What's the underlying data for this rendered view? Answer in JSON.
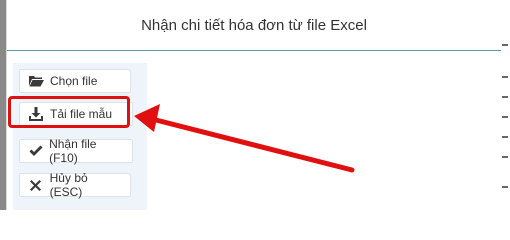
{
  "dialog": {
    "title": "Nhận chi tiết hóa đơn từ file Excel"
  },
  "actions": {
    "choose_file": {
      "label": "Chọn file",
      "icon": "folder-open-icon"
    },
    "download_template": {
      "label": "Tải file mẫu",
      "icon": "download-icon"
    },
    "import_file": {
      "label": "Nhận file (F10)",
      "icon": "check-icon"
    },
    "cancel": {
      "label": "Hủy bỏ (ESC)",
      "icon": "close-icon"
    }
  },
  "annotation": {
    "highlight_color": "#e01010",
    "target": "download_template"
  }
}
